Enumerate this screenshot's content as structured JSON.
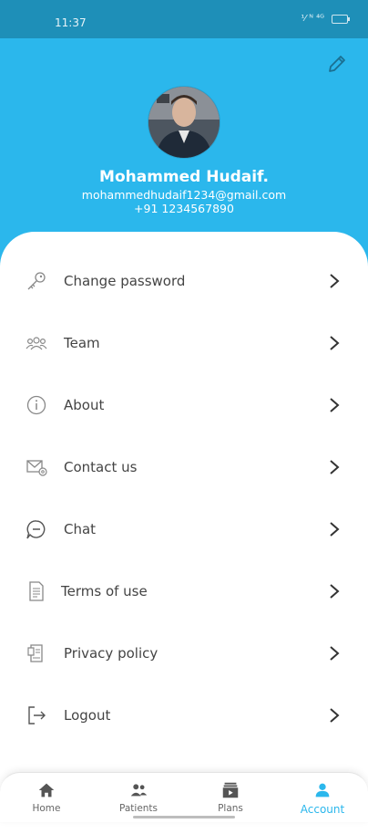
{
  "status_bar": {
    "time": "11:37",
    "indicators": "⅟ ᴺ ⁴ᴳ"
  },
  "profile": {
    "name": "Mohammed Hudaif.",
    "email": "mohammedhudaif1234@gmail.com",
    "phone": "+91 1234567890"
  },
  "menu": [
    {
      "label": "Change password",
      "icon": "key-icon"
    },
    {
      "label": "Team",
      "icon": "team-icon"
    },
    {
      "label": "About",
      "icon": "info-icon"
    },
    {
      "label": "Contact us",
      "icon": "mail-icon"
    },
    {
      "label": "Chat",
      "icon": "chat-icon"
    },
    {
      "label": "Terms of use",
      "icon": "document-icon"
    },
    {
      "label": "Privacy policy",
      "icon": "privacy-icon"
    },
    {
      "label": "Logout",
      "icon": "logout-icon"
    }
  ],
  "bottom_nav": [
    {
      "label": "Home",
      "icon": "home-icon"
    },
    {
      "label": "Patients",
      "icon": "patients-icon"
    },
    {
      "label": "Plans",
      "icon": "plans-icon"
    },
    {
      "label": "Account",
      "icon": "account-icon",
      "active": true
    }
  ],
  "colors": {
    "header": "#2bb7ec",
    "status_bar": "#1e8fb8",
    "accent": "#2bb7ec"
  }
}
